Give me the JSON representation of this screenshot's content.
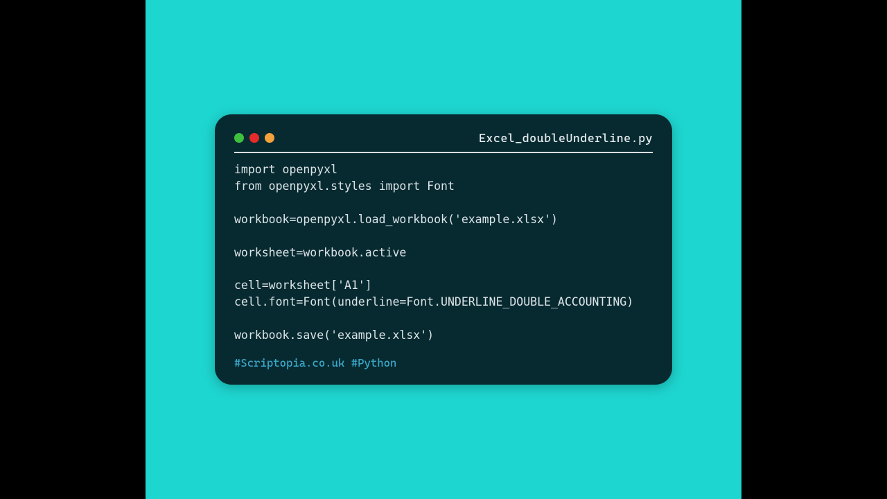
{
  "window": {
    "filename": "Excel_doubleUnderline.py",
    "dots": [
      "green",
      "red",
      "orange"
    ]
  },
  "code": {
    "lines": [
      "import openpyxl",
      "from openpyxl.styles import Font",
      "",
      "workbook=openpyxl.load_workbook('example.xlsx')",
      "",
      "worksheet=workbook.active",
      "",
      "cell=worksheet['A1']",
      "cell.font=Font(underline=Font.UNDERLINE_DOUBLE_ACCOUNTING)",
      "",
      "workbook.save('example.xlsx')"
    ]
  },
  "footer": {
    "text": "#Scriptopia.co.uk #Python"
  }
}
